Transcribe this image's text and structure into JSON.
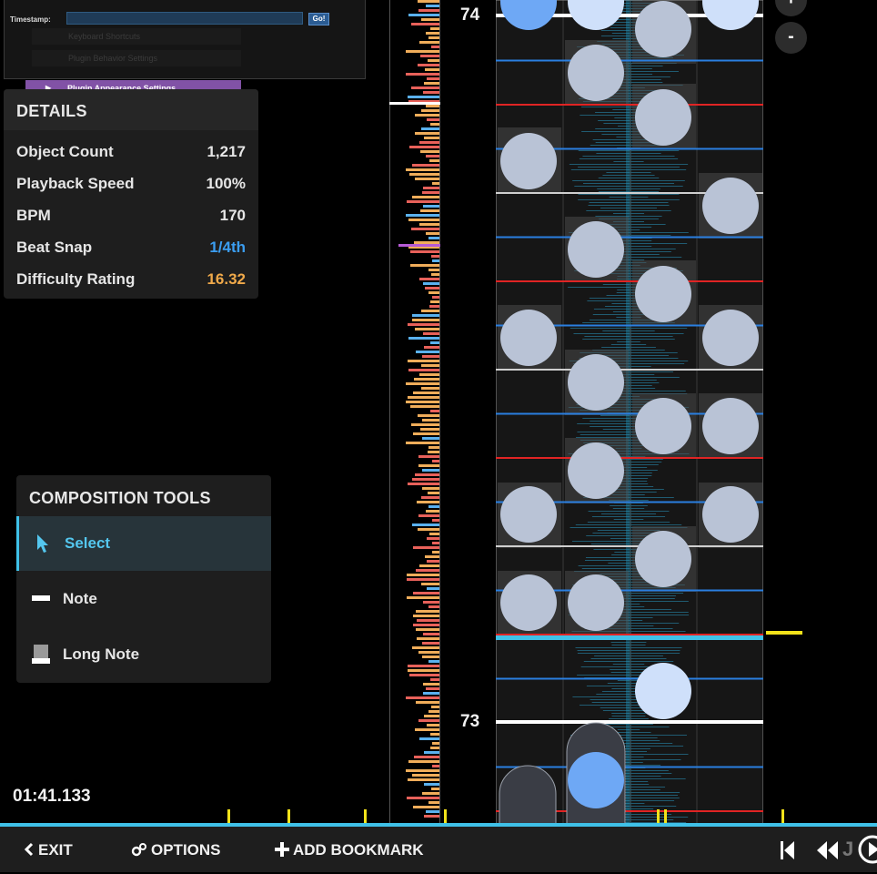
{
  "plugin_window": {
    "timestamp_label": "Timestamp:",
    "timestamp_value": "",
    "go_label": "Go!",
    "faded_items": [
      "Keyboard Shortcuts",
      "Plugin Behavior Settings"
    ],
    "appearance_label": "Plugin Appearance Settings"
  },
  "details": {
    "title": "DETAILS",
    "rows": [
      {
        "label": "Object Count",
        "value": "1,217",
        "color": "#e6e6e6"
      },
      {
        "label": "Playback Speed",
        "value": "100%",
        "color": "#e6e6e6"
      },
      {
        "label": "BPM",
        "value": "170",
        "color": "#e6e6e6"
      },
      {
        "label": "Beat Snap",
        "value": "1/4th",
        "color": "#3b9df0"
      },
      {
        "label": "Difficulty Rating",
        "value": "16.32",
        "color": "#f0a94a"
      }
    ]
  },
  "composition_tools": {
    "title": "COMPOSITION TOOLS",
    "tools": [
      {
        "label": "Select",
        "icon": "cursor-icon",
        "active": true
      },
      {
        "label": "Note",
        "icon": "note-icon",
        "active": false
      },
      {
        "label": "Long Note",
        "icon": "long-note-icon",
        "active": false
      }
    ]
  },
  "time": "01:41.133",
  "measures": [
    "74",
    "73"
  ],
  "zoom": {
    "in": "+",
    "out": "-"
  },
  "bottom_bar": {
    "exit": "EXIT",
    "options": "OPTIONS",
    "add_bookmark": "ADD BOOKMARK"
  },
  "colors": {
    "accent": "#3fc1e8",
    "note": "#b9c3d6",
    "note_highlight": "#6ea8f5",
    "snap_red": "#e02424",
    "snap_blue": "#2a7fe0",
    "beat_line": "#d8d8d8",
    "bookmark": "#f2e21a"
  }
}
